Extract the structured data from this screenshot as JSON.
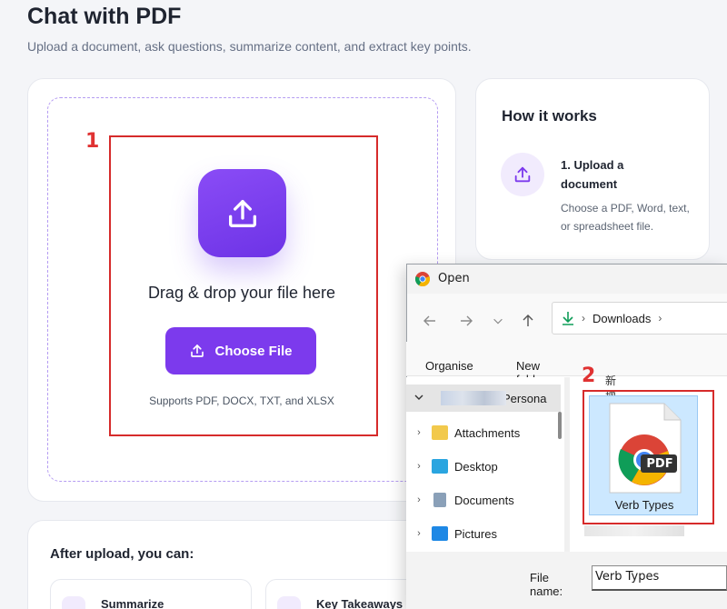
{
  "page": {
    "title": "Chat with PDF",
    "subtitle": "Upload a document, ask questions, summarize content, and extract key points."
  },
  "upload": {
    "drag_text": "Drag & drop your file here",
    "choose_button": "Choose File",
    "supports": "Supports PDF, DOCX, TXT, and XLSX",
    "icon": "upload-icon"
  },
  "how_it_works": {
    "title": "How it works",
    "step1_title": "1. Upload a document",
    "step1_desc": "Choose a PDF, Word, text, or spreadsheet file."
  },
  "after_upload": {
    "title": "After upload, you can:",
    "features": [
      "Summarize",
      "Key Takeaways"
    ]
  },
  "annotations": {
    "one": "1",
    "two": "2",
    "color": "#d62b2b"
  },
  "dialog": {
    "title": "Open",
    "path_folder": "Downloads",
    "toolbar_organise": "Organise",
    "toolbar_new_folder": "New folder",
    "nav_items": [
      "Persona",
      "Attachments",
      "Desktop",
      "Documents",
      "Pictures"
    ],
    "group_label": "新增",
    "file_name": "Verb Types",
    "file_badge": "PDF",
    "file_name_label": "File name:",
    "file_name_value": "Verb Types"
  },
  "colors": {
    "accent": "#7c3aed",
    "background": "#f4f5f8"
  }
}
